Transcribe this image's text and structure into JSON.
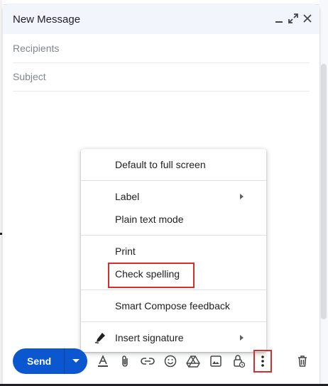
{
  "compose": {
    "title": "New Message",
    "recipients_placeholder": "Recipients",
    "subject_placeholder": "Subject"
  },
  "menu": {
    "items": [
      {
        "label": "Default to full screen"
      },
      {
        "label": "Label",
        "has_submenu": true
      },
      {
        "label": "Plain text mode"
      },
      {
        "label": "Print"
      },
      {
        "label": "Check spelling",
        "highlighted": true
      },
      {
        "label": "Smart Compose feedback"
      },
      {
        "label": "Insert signature",
        "has_submenu": true,
        "icon": "pen-icon"
      }
    ]
  },
  "toolbar": {
    "send_label": "Send",
    "icons": [
      "formatting-options-icon",
      "attach-file-icon",
      "insert-link-icon",
      "emoji-icon",
      "google-drive-icon",
      "insert-photo-icon",
      "confidential-mode-icon",
      "more-options-icon",
      "discard-draft-icon"
    ]
  },
  "colors": {
    "accent": "#0b57d0",
    "header_bg": "#f2f6fc",
    "highlight_border": "#d32f2f"
  }
}
